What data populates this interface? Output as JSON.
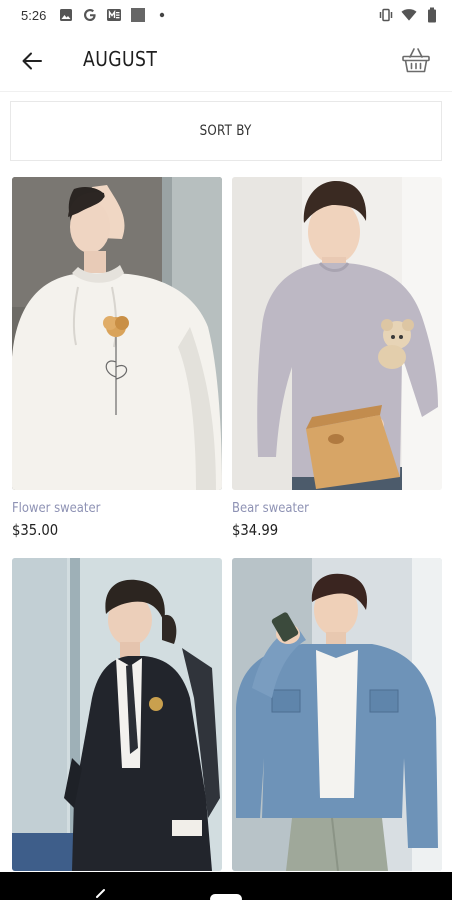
{
  "status_bar": {
    "time": "5:26",
    "left_icons": [
      "gallery-icon",
      "google-icon",
      "news-icon",
      "square-app-icon",
      "dot-icon"
    ],
    "right_icons": [
      "vibrate-icon",
      "wifi-icon",
      "battery-icon"
    ]
  },
  "app_bar": {
    "title": "AUGUST",
    "back_icon": "arrow-left-icon",
    "basket_icon": "basket-icon"
  },
  "sort": {
    "label": "SORT BY"
  },
  "products": [
    {
      "name": "Flower sweater",
      "price": "$35.00"
    },
    {
      "name": "Bear sweater",
      "price": "$34.99"
    },
    {
      "name": "",
      "price": ""
    },
    {
      "name": "",
      "price": ""
    }
  ],
  "colors": {
    "product_name": "#8e92b4",
    "price": "#222222",
    "nav_bar": "#000000"
  }
}
